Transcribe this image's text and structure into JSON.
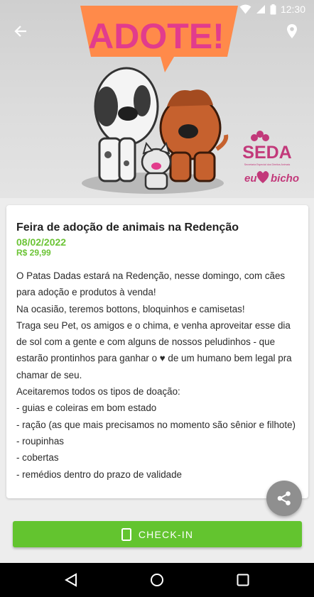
{
  "status_bar": {
    "time": "12:30"
  },
  "hero": {
    "banner_text": "ADOTE!",
    "logo_text": "SEDA",
    "logo_subtext": "Secretaria Especial dos Direitos Animais",
    "slogan_prefix": "eu",
    "slogan_suffix": "bicho"
  },
  "event": {
    "title": "Feira de adoção de animais na Redenção",
    "date": "08/02/2022",
    "price": "R$ 29,99",
    "description": [
      "O Patas Dadas estará na Redenção, nesse domingo, com cães para adoção e produtos à venda!",
      "Na ocasião, teremos bottons, bloquinhos e camisetas!",
      "Traga seu Pet, os amigos e o chima, e venha aproveitar esse dia de sol com a gente e com alguns de nossos peludinhos - que estarão prontinhos para ganhar o ♥ de um humano bem legal pra chamar de seu.",
      "Aceitaremos todos os tipos de doação:",
      "- guias e coleiras em bom estado",
      "- ração (as que mais precisamos no momento são sênior e filhote)",
      "- roupinhas",
      "- cobertas",
      "- remédios dentro do prazo de validade"
    ]
  },
  "checkin": {
    "label": "CHECK-IN"
  },
  "colors": {
    "accent": "#63c42f",
    "date": "#6cc436",
    "banner": "#ff8a4a",
    "logo": "#c2397a"
  }
}
